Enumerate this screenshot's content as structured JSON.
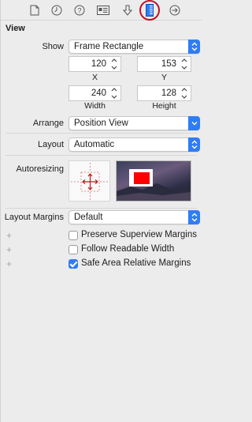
{
  "toolbar": {
    "tabs": [
      {
        "icon": "file-icon"
      },
      {
        "icon": "clock-icon"
      },
      {
        "icon": "help-icon"
      },
      {
        "icon": "identity-card-icon"
      },
      {
        "icon": "attributes-arrow-icon"
      },
      {
        "icon": "size-ruler-icon",
        "active": true
      },
      {
        "icon": "connections-arrow-icon"
      }
    ],
    "highlight_color": "#c1121f"
  },
  "section": {
    "title": "View"
  },
  "show": {
    "label": "Show",
    "value": "Frame Rectangle"
  },
  "frame": {
    "x": {
      "value": "120",
      "caption": "X"
    },
    "y": {
      "value": "153",
      "caption": "Y"
    },
    "width": {
      "value": "240",
      "caption": "Width"
    },
    "height": {
      "value": "128",
      "caption": "Height"
    }
  },
  "arrange": {
    "label": "Arrange",
    "value": "Position View"
  },
  "layout": {
    "label": "Layout",
    "value": "Automatic"
  },
  "autoresizing": {
    "label": "Autoresizing"
  },
  "layout_margins": {
    "label": "Layout Margins",
    "value": "Default"
  },
  "options": [
    {
      "label": "Preserve Superview Margins",
      "checked": false
    },
    {
      "label": "Follow Readable Width",
      "checked": false
    },
    {
      "label": "Safe Area Relative Margins",
      "checked": true
    }
  ],
  "plus_symbol": "+",
  "accent_color": "#2f7cf6"
}
